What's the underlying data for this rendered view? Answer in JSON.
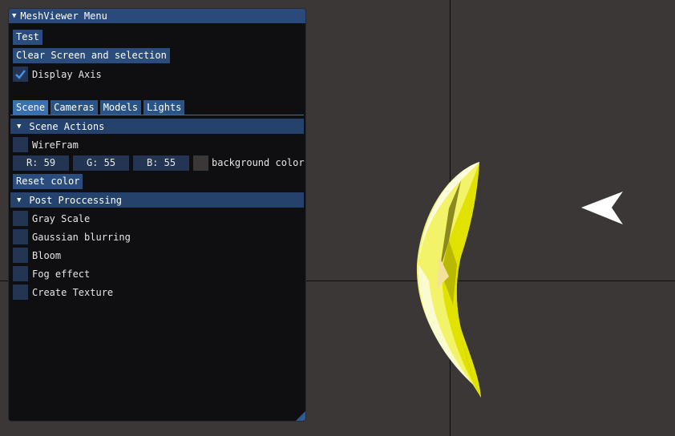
{
  "window": {
    "title": "MeshViewer Menu"
  },
  "buttons": {
    "test": "Test",
    "clear": "Clear Screen and selection",
    "reset_color": "Reset color"
  },
  "display_axis": {
    "label": "Display Axis",
    "checked": true
  },
  "tabs": [
    "Scene",
    "Cameras",
    "Models",
    "Lights"
  ],
  "scene_actions": {
    "header": "Scene Actions",
    "wireframe_label": "WireFram",
    "r": "R: 59",
    "g": "G: 55",
    "b": "B: 55",
    "background_label": "background color",
    "background_color": "#3b3737"
  },
  "post_processing": {
    "header": "Post Proccessing",
    "items": [
      "Gray Scale",
      "Gaussian blurring",
      "Bloom",
      "Fog effect",
      "Create Texture"
    ]
  },
  "colors": {
    "accent": "#2a4d7d",
    "header": "#294a7a",
    "mesh": "#f0f000",
    "background": "#3b3737"
  }
}
